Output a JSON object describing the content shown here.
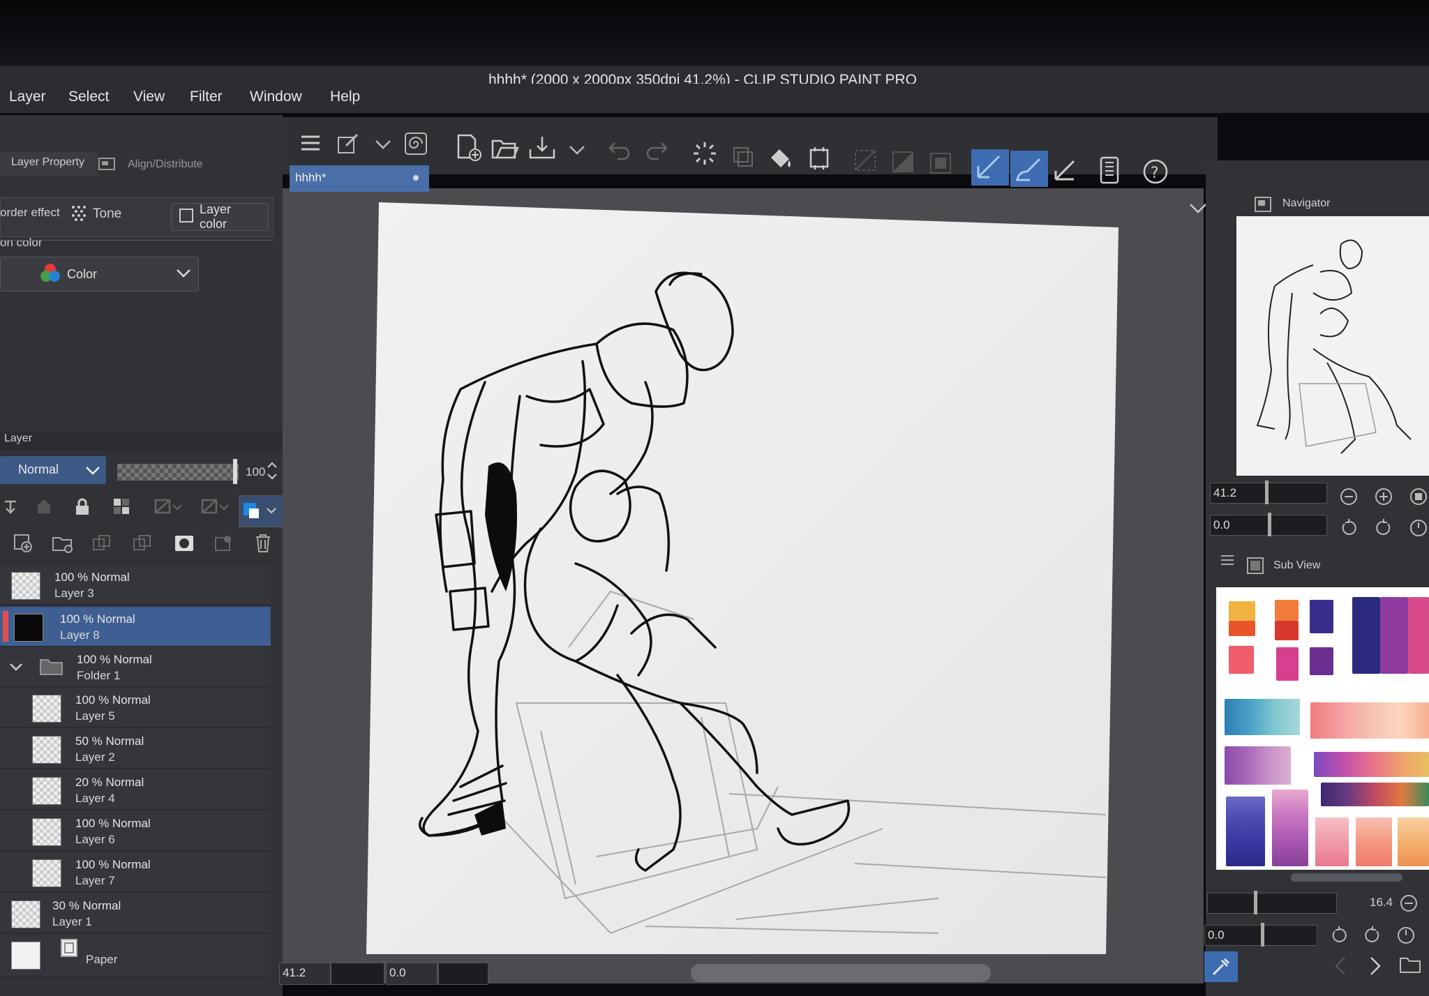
{
  "window": {
    "title": "hhhh* (2000 x 2000px 350dpi 41.2%) - CLIP STUDIO PAINT PRO"
  },
  "menu": [
    "Layer",
    "Select",
    "View",
    "Filter",
    "Window",
    "Help"
  ],
  "left_panel": {
    "tabs": {
      "layer_property": "Layer Property",
      "align_distribute": "Align/Distribute"
    },
    "effects": {
      "border_effect": "order effect",
      "tone": "Tone",
      "layer_color": "Layer color"
    },
    "expression_color_label": "on color",
    "expression_color_value": "Color"
  },
  "layer_panel": {
    "title": "Layer",
    "blend_mode": "Normal",
    "opacity": "100",
    "layers": [
      {
        "meta": "100 % Normal",
        "name": "Layer 3"
      },
      {
        "meta": "100 % Normal",
        "name": "Layer 8"
      },
      {
        "meta": "100 % Normal",
        "name": "Folder 1"
      },
      {
        "meta": "100 % Normal",
        "name": "Layer 5"
      },
      {
        "meta": "50 % Normal",
        "name": "Layer 2"
      },
      {
        "meta": "20 % Normal",
        "name": "Layer 4"
      },
      {
        "meta": "100 % Normal",
        "name": "Layer 6"
      },
      {
        "meta": "100 % Normal",
        "name": "Layer 7"
      },
      {
        "meta": "30 % Normal",
        "name": "Layer 1"
      },
      {
        "meta": "",
        "name": "Paper"
      }
    ],
    "selected_layer": "Layer 8"
  },
  "document_tab": {
    "label": "hhhh*"
  },
  "status": {
    "zoom": "41.2",
    "angle": "0.0"
  },
  "navigator": {
    "title": "Navigator",
    "zoom": "41.2",
    "rotation": "0.0"
  },
  "sub_view": {
    "title": "Sub View",
    "zoom": "16.4",
    "rotation": "0.0"
  },
  "colors": {
    "accent": "#3d6cb0",
    "panel": "#303236",
    "selected_row": "#3f5f93"
  },
  "icons": [
    "menu-icon",
    "canvas-icon",
    "new-file-icon",
    "open-folder-icon",
    "save-icon",
    "undo-icon",
    "redo-icon",
    "loading-icon",
    "fill-icon",
    "transform-icon",
    "selection-icon",
    "pen-icon",
    "brush-icon",
    "ruler-icon",
    "help-icon",
    "navigator-icon",
    "subview-icon",
    "eyedropper-icon"
  ]
}
